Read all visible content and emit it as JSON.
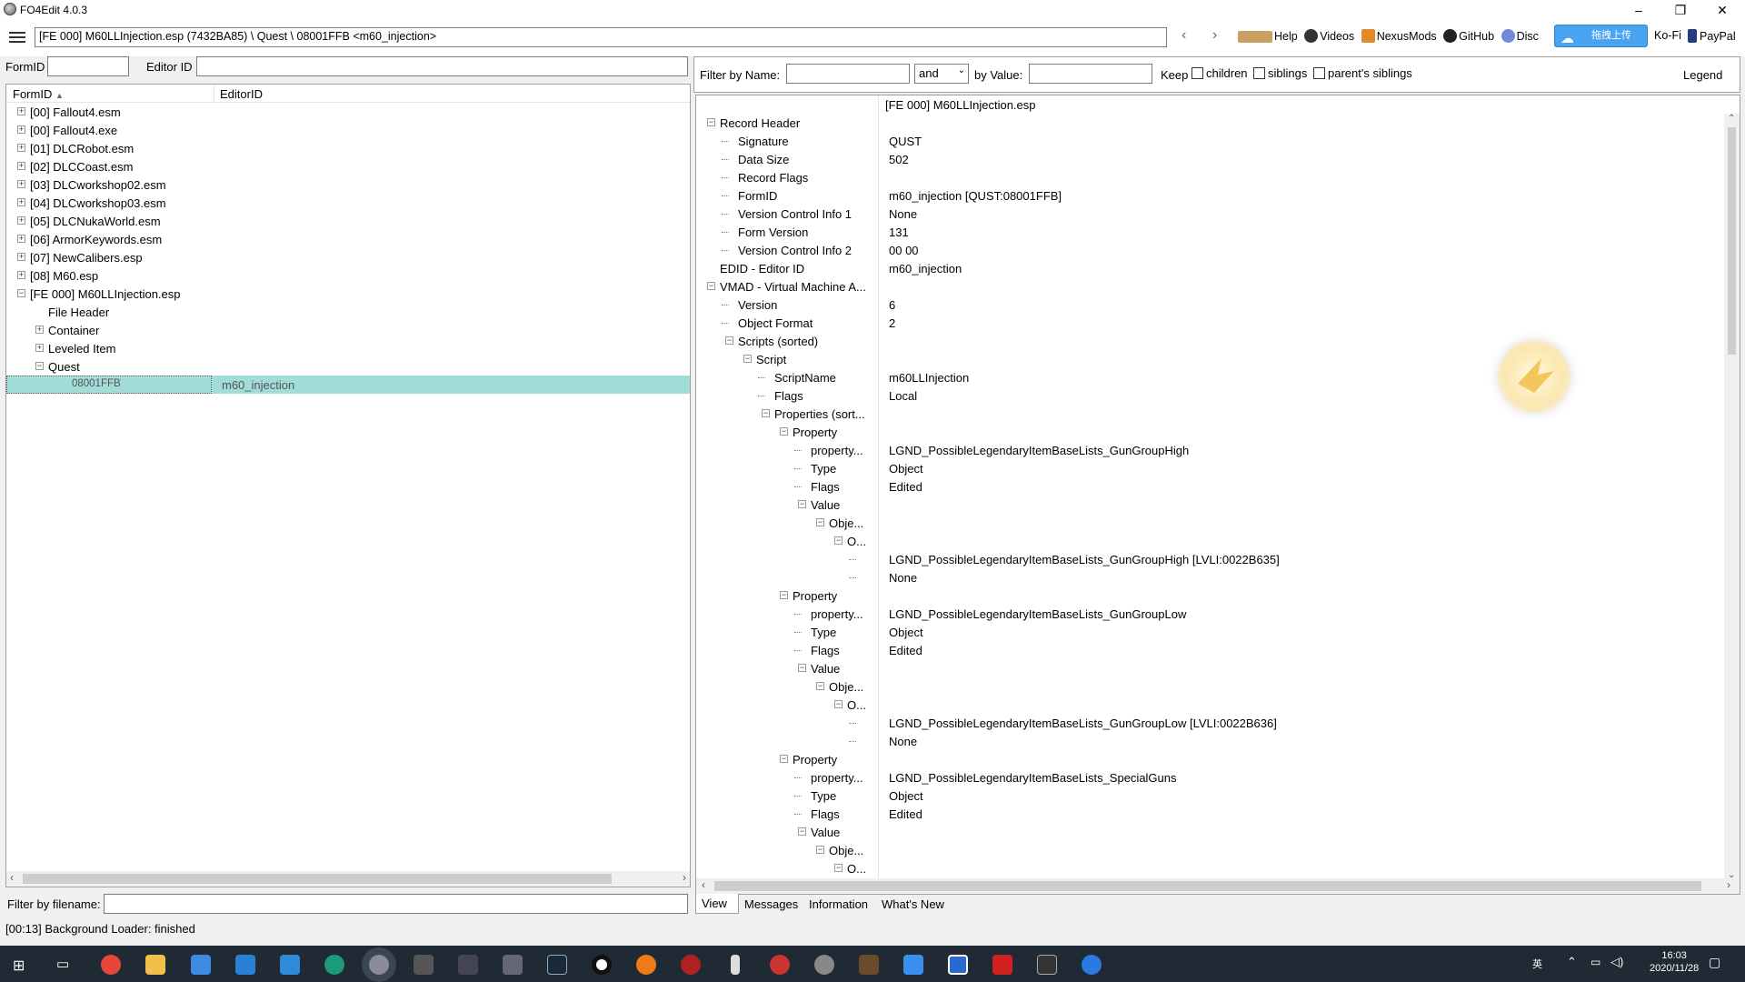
{
  "window": {
    "title": "FO4Edit 4.0.3",
    "min": "–",
    "restore": "❐",
    "close": "✕"
  },
  "toolbar": {
    "path": "[FE 000] M60LLInjection.esp (7432BA85) \\ Quest \\ 08001FFB <m60_injection>",
    "back": "‹",
    "forward": "›",
    "links": [
      "Help",
      "Videos",
      "NexusMods",
      "GitHub",
      "Disc",
      "Ko-Fi",
      "PayPal"
    ],
    "upload": "拖拽上传"
  },
  "left": {
    "formid_label": "FormID",
    "editorid_label": "Editor ID",
    "col_formid": "FormID",
    "col_editorid": "EditorID",
    "sort_arrow": "▲",
    "tree": [
      {
        "label": "[00] Fallout4.esm",
        "level": 0,
        "exp": "+"
      },
      {
        "label": "[00] Fallout4.exe",
        "level": 0,
        "exp": "+"
      },
      {
        "label": "[01] DLCRobot.esm",
        "level": 0,
        "exp": "+"
      },
      {
        "label": "[02] DLCCoast.esm",
        "level": 0,
        "exp": "+"
      },
      {
        "label": "[03] DLCworkshop02.esm",
        "level": 0,
        "exp": "+"
      },
      {
        "label": "[04] DLCworkshop03.esm",
        "level": 0,
        "exp": "+"
      },
      {
        "label": "[05] DLCNukaWorld.esm",
        "level": 0,
        "exp": "+"
      },
      {
        "label": "[06] ArmorKeywords.esm",
        "level": 0,
        "exp": "+"
      },
      {
        "label": "[07] NewCalibers.esp",
        "level": 0,
        "exp": "+"
      },
      {
        "label": "[08] M60.esp",
        "level": 0,
        "exp": "+"
      },
      {
        "label": "[FE 000] M60LLInjection.esp",
        "level": 0,
        "exp": "−"
      },
      {
        "label": "File Header",
        "level": 1,
        "exp": ""
      },
      {
        "label": "Container",
        "level": 1,
        "exp": "+"
      },
      {
        "label": "Leveled Item",
        "level": 1,
        "exp": "+"
      },
      {
        "label": "Quest",
        "level": 1,
        "exp": "−"
      }
    ],
    "selected": {
      "formid": "08001FFB",
      "editorid": "m60_injection"
    },
    "filter_label": "Filter by filename:"
  },
  "right": {
    "filter_name": "Filter by Name:",
    "and": "and",
    "by_value": "by Value:",
    "keep": "Keep",
    "children": "children",
    "siblings": "siblings",
    "parents": "parent's siblings",
    "legend": "Legend",
    "header_col": "[FE 000] M60LLInjection.esp",
    "rows": [
      {
        "l": 0,
        "exp": "−",
        "name": "Record Header",
        "val": ""
      },
      {
        "l": 1,
        "exp": "",
        "name": "Signature",
        "val": "QUST"
      },
      {
        "l": 1,
        "exp": "",
        "name": "Data Size",
        "val": "502"
      },
      {
        "l": 1,
        "exp": "",
        "name": "Record Flags",
        "val": ""
      },
      {
        "l": 1,
        "exp": "",
        "name": "FormID",
        "val": "m60_injection [QUST:08001FFB]"
      },
      {
        "l": 1,
        "exp": "",
        "name": "Version Control Info 1",
        "val": "None"
      },
      {
        "l": 1,
        "exp": "",
        "name": "Form Version",
        "val": "131"
      },
      {
        "l": 1,
        "exp": "",
        "name": "Version Control Info 2",
        "val": "00 00"
      },
      {
        "l": 0,
        "exp": "",
        "name": "EDID - Editor ID",
        "val": "m60_injection"
      },
      {
        "l": 0,
        "exp": "−",
        "name": "VMAD - Virtual Machine A...",
        "val": ""
      },
      {
        "l": 1,
        "exp": "",
        "name": "Version",
        "val": "6"
      },
      {
        "l": 1,
        "exp": "",
        "name": "Object Format",
        "val": "2"
      },
      {
        "l": 1,
        "exp": "−",
        "name": "Scripts (sorted)",
        "val": ""
      },
      {
        "l": 2,
        "exp": "−",
        "name": "Script",
        "val": ""
      },
      {
        "l": 3,
        "exp": "",
        "name": "ScriptName",
        "val": "m60LLInjection"
      },
      {
        "l": 3,
        "exp": "",
        "name": "Flags",
        "val": "Local"
      },
      {
        "l": 3,
        "exp": "−",
        "name": "Properties (sort...",
        "val": ""
      },
      {
        "l": 4,
        "exp": "−",
        "name": "Property",
        "val": ""
      },
      {
        "l": 5,
        "exp": "",
        "name": "property...",
        "val": "LGND_PossibleLegendaryItemBaseLists_GunGroupHigh"
      },
      {
        "l": 5,
        "exp": "",
        "name": "Type",
        "val": "Object"
      },
      {
        "l": 5,
        "exp": "",
        "name": "Flags",
        "val": "Edited"
      },
      {
        "l": 5,
        "exp": "−",
        "name": "Value",
        "val": ""
      },
      {
        "l": 6,
        "exp": "−",
        "name": "Obje...",
        "val": ""
      },
      {
        "l": 7,
        "exp": "−",
        "name": "O...",
        "val": ""
      },
      {
        "l": 8,
        "exp": "",
        "name": "",
        "val": "LGND_PossibleLegendaryItemBaseLists_GunGroupHigh [LVLI:0022B635]"
      },
      {
        "l": 8,
        "exp": "",
        "name": "",
        "val": "None"
      },
      {
        "l": 4,
        "exp": "−",
        "name": "Property",
        "val": ""
      },
      {
        "l": 5,
        "exp": "",
        "name": "property...",
        "val": "LGND_PossibleLegendaryItemBaseLists_GunGroupLow"
      },
      {
        "l": 5,
        "exp": "",
        "name": "Type",
        "val": "Object"
      },
      {
        "l": 5,
        "exp": "",
        "name": "Flags",
        "val": "Edited"
      },
      {
        "l": 5,
        "exp": "−",
        "name": "Value",
        "val": ""
      },
      {
        "l": 6,
        "exp": "−",
        "name": "Obje...",
        "val": ""
      },
      {
        "l": 7,
        "exp": "−",
        "name": "O...",
        "val": ""
      },
      {
        "l": 8,
        "exp": "",
        "name": "",
        "val": "LGND_PossibleLegendaryItemBaseLists_GunGroupLow [LVLI:0022B636]"
      },
      {
        "l": 8,
        "exp": "",
        "name": "",
        "val": "None"
      },
      {
        "l": 4,
        "exp": "−",
        "name": "Property",
        "val": ""
      },
      {
        "l": 5,
        "exp": "",
        "name": "property...",
        "val": "LGND_PossibleLegendaryItemBaseLists_SpecialGuns"
      },
      {
        "l": 5,
        "exp": "",
        "name": "Type",
        "val": "Object"
      },
      {
        "l": 5,
        "exp": "",
        "name": "Flags",
        "val": "Edited"
      },
      {
        "l": 5,
        "exp": "−",
        "name": "Value",
        "val": ""
      },
      {
        "l": 6,
        "exp": "−",
        "name": "Obje...",
        "val": ""
      },
      {
        "l": 7,
        "exp": "−",
        "name": "O...",
        "val": ""
      }
    ],
    "tabs": [
      "View",
      "Messages",
      "Information",
      "What's New"
    ]
  },
  "status": "[00:13] Background Loader: finished",
  "taskbar": {
    "lang": "英",
    "time": "16:03",
    "date": "2020/11/28"
  }
}
